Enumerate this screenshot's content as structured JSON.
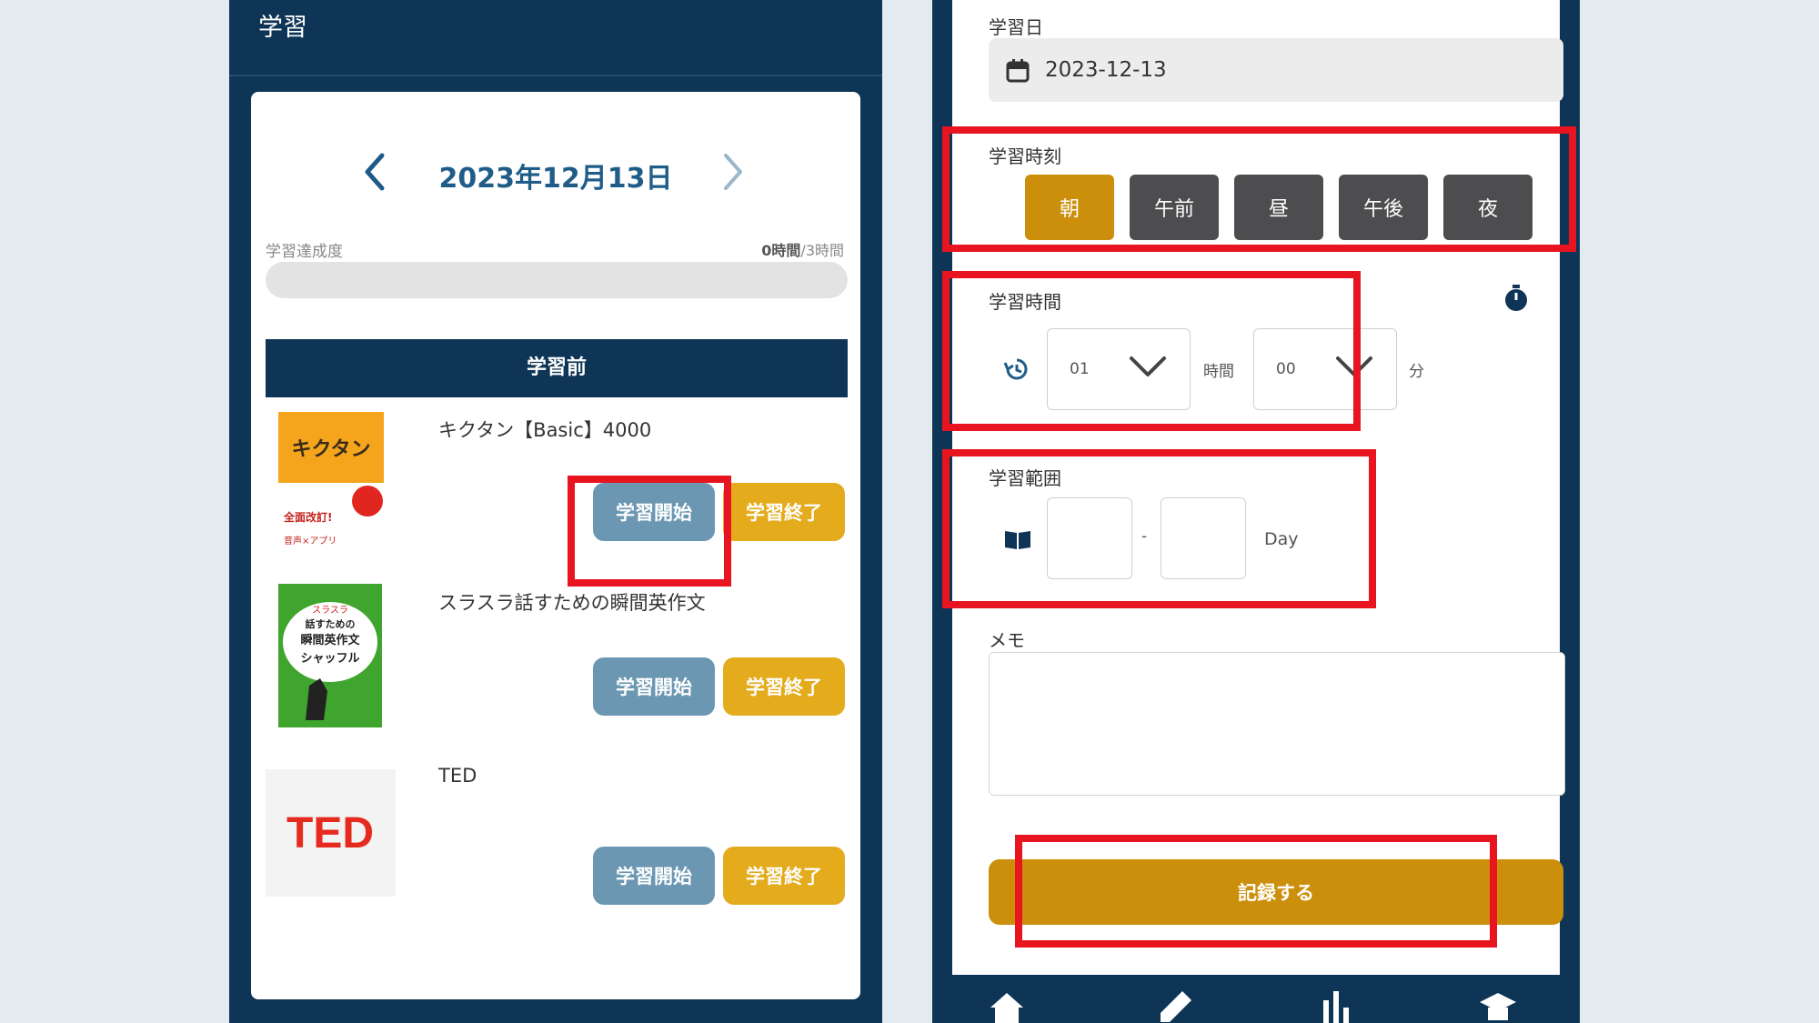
{
  "left_screen": {
    "header_title": "学習",
    "date_nav": {
      "title": "2023年12月13日"
    },
    "progress": {
      "label": "学習達成度",
      "value_done": "0時間",
      "value_total": "/3時間",
      "fraction": 0
    },
    "status_bar_label": "学習前",
    "items": [
      {
        "title": "キクタン【Basic】4000",
        "start_label": "学習開始",
        "end_label": "学習終了",
        "cover_lines": [
          "キクタン",
          "全面改訂!",
          "音声×アプリ"
        ]
      },
      {
        "title": "スラスラ話すための瞬間英作文",
        "start_label": "学習開始",
        "end_label": "学習終了",
        "cover_lines": [
          "スラスラ",
          "話すための",
          "瞬間英作文",
          "シャッフル"
        ]
      },
      {
        "title": "TED",
        "start_label": "学習開始",
        "end_label": "学習終了",
        "cover_lines": [
          "TED"
        ]
      }
    ]
  },
  "right_screen": {
    "date_field": {
      "label": "学習日",
      "value": "2023-12-13"
    },
    "time_of_day": {
      "label": "学習時刻",
      "options": [
        "朝",
        "午前",
        "昼",
        "午後",
        "夜"
      ],
      "selected": "朝"
    },
    "duration": {
      "label": "学習時間",
      "hours": "01",
      "hours_unit": "時間",
      "minutes": "00",
      "minutes_unit": "分"
    },
    "range": {
      "label": "学習範囲",
      "from": "",
      "separator": "-",
      "to": "",
      "unit": "Day"
    },
    "memo": {
      "label": "メモ",
      "value": ""
    },
    "record_button_label": "記録する"
  },
  "colors": {
    "navy": "#0f3556",
    "accent_blue": "#1f5d88",
    "start_button": "#6b97b2",
    "end_button": "#e4ab1d",
    "primary_gold": "#cc8f0c",
    "inactive_time": "#4d4d4f",
    "highlight_red": "#e8141f"
  },
  "icons": {
    "left": [
      "chevron-left-icon",
      "chevron-right-icon"
    ],
    "right": [
      "calendar-icon",
      "stopwatch-icon",
      "history-icon",
      "chevron-down-icon",
      "book-icon",
      "home-icon",
      "pencil-icon",
      "chart-icon",
      "graduation-cap-icon"
    ]
  }
}
